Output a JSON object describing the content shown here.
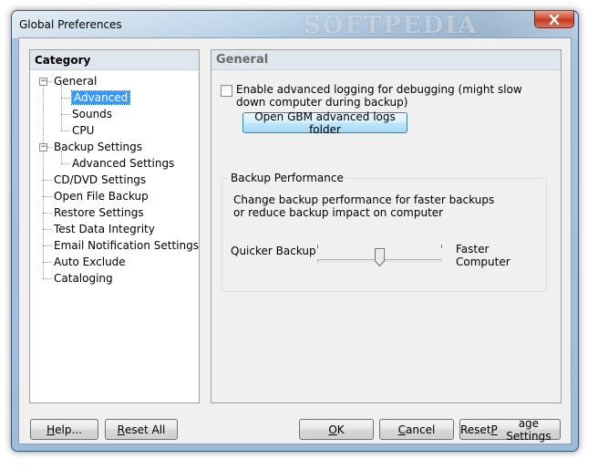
{
  "window": {
    "title": "Global Preferences",
    "watermark": "SOFTPEDIA",
    "close_icon": "close-icon"
  },
  "category": {
    "header": "Category",
    "items": [
      {
        "label": "General",
        "level": 0,
        "expander": "−"
      },
      {
        "label": "Advanced",
        "level": 1,
        "selected": true
      },
      {
        "label": "Sounds",
        "level": 1
      },
      {
        "label": "CPU",
        "level": 1
      },
      {
        "label": "Backup Settings",
        "level": 0,
        "expander": "−"
      },
      {
        "label": "Advanced Settings",
        "level": 1
      },
      {
        "label": "CD/DVD Settings",
        "level": 0
      },
      {
        "label": "Open File Backup",
        "level": 0
      },
      {
        "label": "Restore Settings",
        "level": 0
      },
      {
        "label": "Test Data Integrity",
        "level": 0
      },
      {
        "label": "Email Notification Settings",
        "level": 0
      },
      {
        "label": "Auto Exclude",
        "level": 0
      },
      {
        "label": "Cataloging",
        "level": 0
      }
    ]
  },
  "general": {
    "header": "General",
    "logging_checkbox": {
      "label": "Enable advanced logging for debugging (might slow down computer during backup)",
      "checked": false
    },
    "open_logs_button": "Open GBM advanced logs folder",
    "performance_group": {
      "title": "Backup Performance",
      "description": "Change backup performance for faster backups or reduce backup impact on computer",
      "left_label": "Quicker Backup",
      "right_label": "Faster Computer",
      "slider_position": 0.5
    }
  },
  "buttons": {
    "help": {
      "pre": "",
      "key": "H",
      "post": "elp..."
    },
    "reset_all": {
      "pre": "",
      "key": "R",
      "post": "eset All"
    },
    "ok": {
      "pre": "",
      "key": "O",
      "post": "K"
    },
    "cancel": {
      "pre": "",
      "key": "C",
      "post": "ancel"
    },
    "reset_page": {
      "pre": "Reset ",
      "key": "P",
      "post": "age Settings"
    }
  },
  "colors": {
    "selection": "#3399ff",
    "close_button": "#c23a21"
  }
}
